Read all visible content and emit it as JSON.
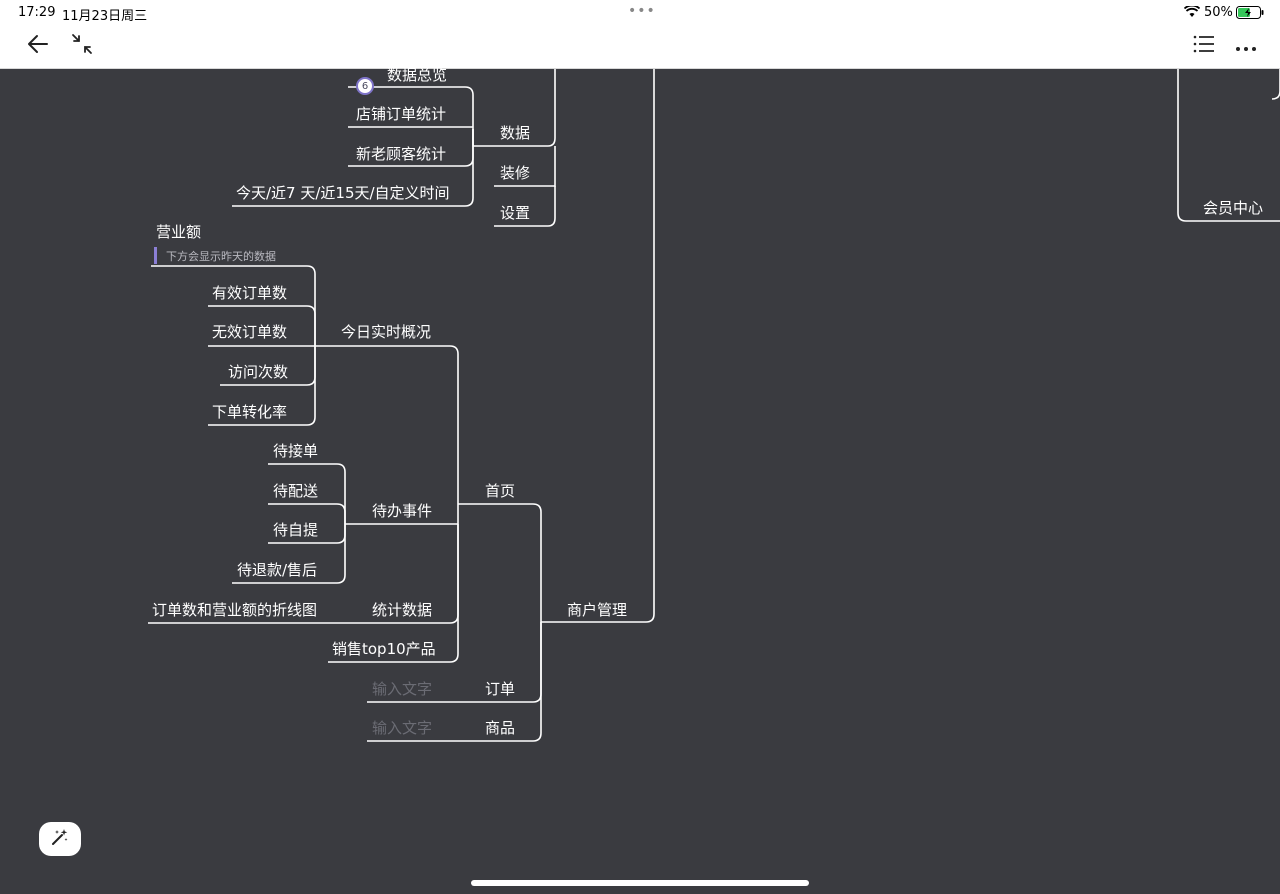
{
  "status_bar": {
    "time": "17:29",
    "date": "11月23日周三",
    "battery": "50%"
  },
  "toolbar": {
    "back_icon": "arrow-left-icon",
    "collapse_icon": "collapse-arrows-icon",
    "outline_icon": "list-icon",
    "more_icon": "more-horizontal-icon"
  },
  "mindmap": {
    "badge_count": "6",
    "nodes": {
      "data_overview": "数据总览",
      "shop_order_stats": "店铺订单统计",
      "new_old_customer_stats": "新老顾客统计",
      "time_range": "今天/近7 天/近15天/自定义时间",
      "data": "数据",
      "decoration": "装修",
      "settings": "设置",
      "member_center": "会员中心",
      "revenue": "营业额",
      "revenue_note": "下方会显示昨天的数据",
      "valid_orders": "有效订单数",
      "invalid_orders": "无效订单数",
      "visits": "访问次数",
      "order_conversion": "下单转化率",
      "today_realtime": "今日实时概况",
      "pending_accept": "待接单",
      "pending_delivery": "待配送",
      "pending_pickup": "待自提",
      "pending_refund": "待退款/售后",
      "todo_events": "待办事件",
      "home": "首页",
      "line_chart": "订单数和营业额的折线图",
      "stats_data": "统计数据",
      "merchant_mgmt": "商户管理",
      "top10_products": "销售top10产品",
      "input_placeholder_1": "输入文字",
      "orders": "订单",
      "input_placeholder_2": "输入文字",
      "products": "商品"
    }
  },
  "colors": {
    "canvas": "#3a3b40",
    "line": "#ffffff",
    "badge_border": "#7f74c9"
  },
  "floating_icon": "magic-wand-icon"
}
